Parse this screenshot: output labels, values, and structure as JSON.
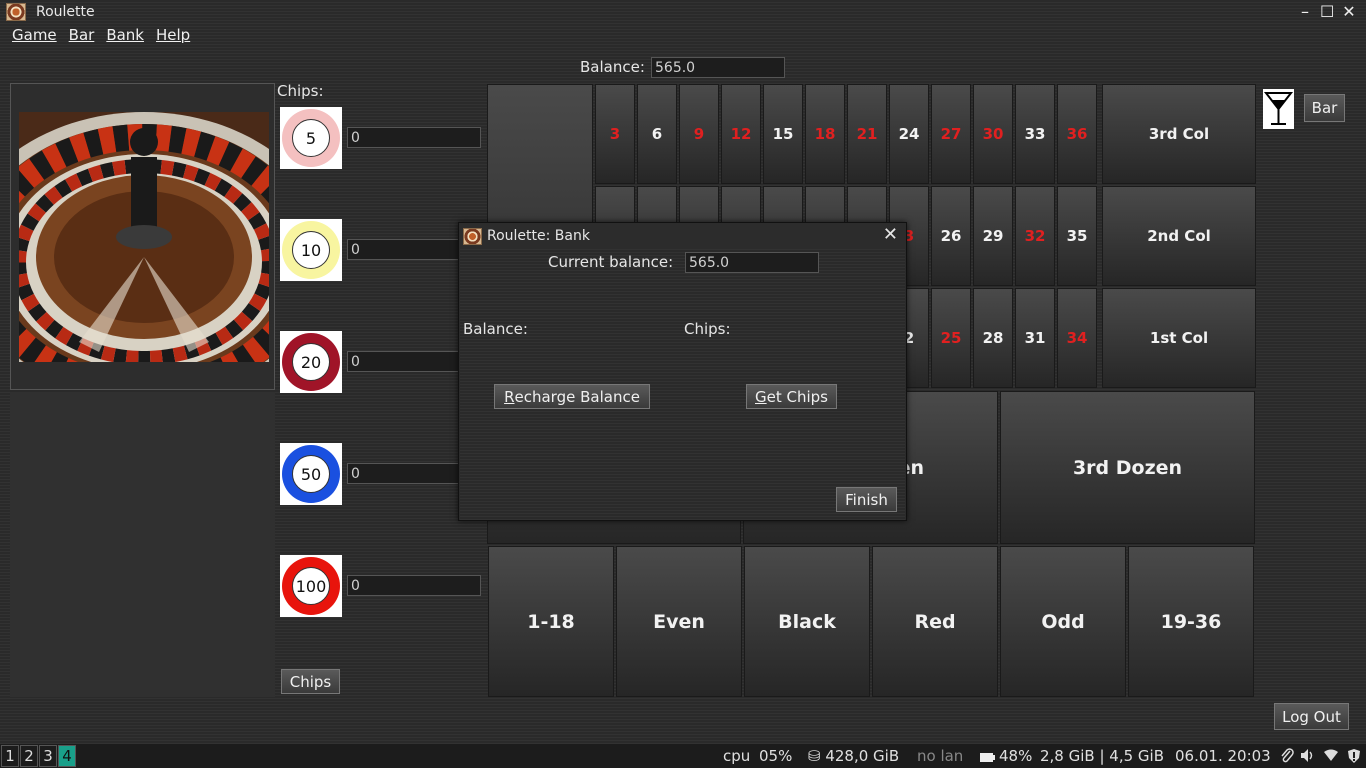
{
  "window": {
    "title": "Roulette"
  },
  "wm": {
    "minimize": "–",
    "maximize": "☐",
    "close": "✕"
  },
  "menu": [
    {
      "label": "Game"
    },
    {
      "label": "Bar"
    },
    {
      "label": "Bank"
    },
    {
      "label": "Help"
    }
  ],
  "balance": {
    "label": "Balance:",
    "value": "565.0"
  },
  "chips": {
    "title": "Chips:",
    "items": [
      {
        "value": "5",
        "count": "0",
        "color": "#f4c0c0"
      },
      {
        "value": "10",
        "count": "0",
        "color": "#f8f5a0"
      },
      {
        "value": "20",
        "count": "0",
        "color": "#a01428"
      },
      {
        "value": "50",
        "count": "0",
        "color": "#1a50e0"
      },
      {
        "value": "100",
        "count": "0",
        "color": "#e8140c"
      }
    ],
    "button": "Chips"
  },
  "table": {
    "row_top": [
      {
        "n": "3",
        "red": true
      },
      {
        "n": "6",
        "red": false
      },
      {
        "n": "9",
        "red": true
      },
      {
        "n": "12",
        "red": true
      },
      {
        "n": "15",
        "red": false
      },
      {
        "n": "18",
        "red": true
      },
      {
        "n": "21",
        "red": true
      },
      {
        "n": "24",
        "red": false
      },
      {
        "n": "27",
        "red": true
      },
      {
        "n": "30",
        "red": true
      },
      {
        "n": "33",
        "red": false
      },
      {
        "n": "36",
        "red": true
      }
    ],
    "row_mid_visible": [
      {
        "n": "3",
        "red": true
      },
      {
        "n": "26",
        "red": false
      },
      {
        "n": "29",
        "red": false
      },
      {
        "n": "32",
        "red": true
      },
      {
        "n": "35",
        "red": false
      }
    ],
    "row_bot_visible": [
      {
        "n": "2",
        "red": false
      },
      {
        "n": "25",
        "red": true
      },
      {
        "n": "28",
        "red": false
      },
      {
        "n": "31",
        "red": false
      },
      {
        "n": "34",
        "red": true
      }
    ],
    "columns": [
      "3rd Col",
      "2nd Col",
      "1st Col"
    ],
    "dozen_partial": "en",
    "dozen_3": "3rd Dozen",
    "outside": [
      "1-18",
      "Even",
      "Black",
      "Red",
      "Odd",
      "19-36"
    ]
  },
  "bar": {
    "button": "Bar",
    "icon": "cocktail-glass-icon"
  },
  "logout": "Log Out",
  "dialog": {
    "title": "Roulette: Bank",
    "close": "✕",
    "current_balance_label": "Current balance:",
    "current_balance_value": "565.0",
    "balance_label": "Balance:",
    "chips_label": "Chips:",
    "recharge": {
      "first": "R",
      "rest": "echarge Balance"
    },
    "get_chips": {
      "first": "G",
      "rest": "et Chips"
    },
    "finish": "Finish"
  },
  "taskbar": {
    "workspaces": [
      "1",
      "2",
      "3",
      "4"
    ],
    "active_workspace": "4",
    "cpu_label": "cpu",
    "cpu_value": "05%",
    "disk": "⛁ 428,0 GiB",
    "network": "no lan",
    "battery": "48%",
    "memory": "2,8 GiB | 4,5 GiB",
    "datetime": "06.01. 20:03"
  }
}
